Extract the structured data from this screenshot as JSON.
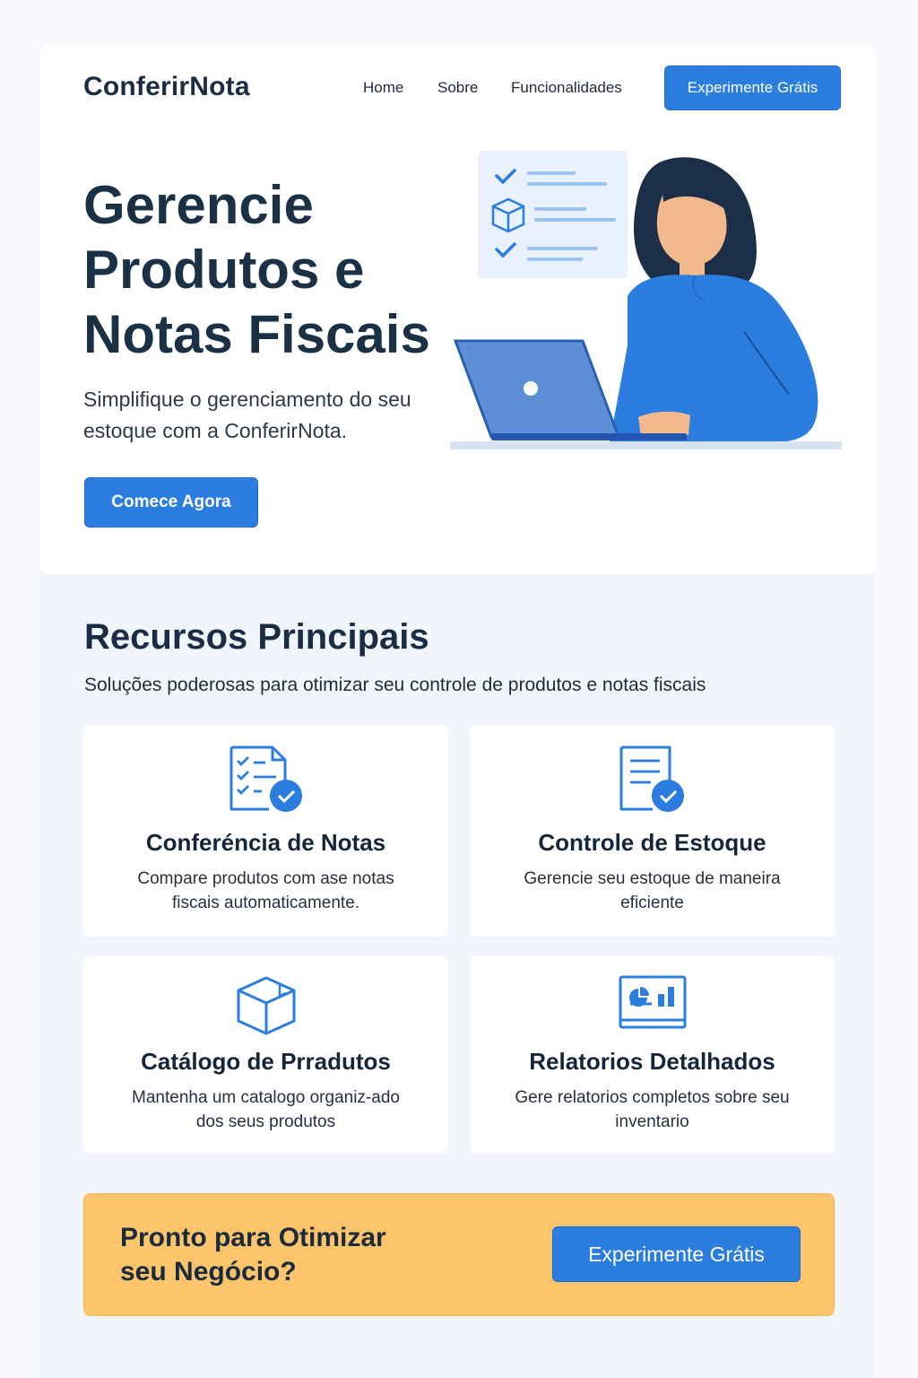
{
  "header": {
    "logo": "ConferirNota",
    "nav": [
      "Home",
      "Sobre",
      "Funcionalidades"
    ],
    "cta": "Experimente Grátis"
  },
  "hero": {
    "title": "Gerencie Produtos e Notas Fiscais",
    "subtitle": "Simplifique o gerenciamento do seu estoque com a ConferirNota.",
    "cta": "Comece Agora"
  },
  "features": {
    "title": "Recursos Principais",
    "subtitle": "Soluções poderosas para otimizar seu controle de produtos e notas fiscais",
    "cards": [
      {
        "icon": "checklist-document-icon",
        "title": "Conferéncia de Notas",
        "desc": "Compare produtos com ase notas fiscais automaticamente."
      },
      {
        "icon": "document-check-icon",
        "title": "Controle de Estoque",
        "desc": "Gerencie seu estoque de maneira eficiente"
      },
      {
        "icon": "box-icon",
        "title": "Catálogo de Prradutos",
        "desc": "Mantenha um catalogo organiz-ado dos seus produtos"
      },
      {
        "icon": "report-chart-icon",
        "title": "Relatorios Detalhados",
        "desc": "Gere relatorios completos sobre seu inventario"
      }
    ]
  },
  "banner": {
    "title": "Pronto para Otimizar seu Negócio?",
    "cta": "Experimente Grátis"
  },
  "colors": {
    "primary": "#2b7de0",
    "banner": "#fcc56b",
    "heading": "#1b2d44",
    "background": "#f1f6fd"
  }
}
